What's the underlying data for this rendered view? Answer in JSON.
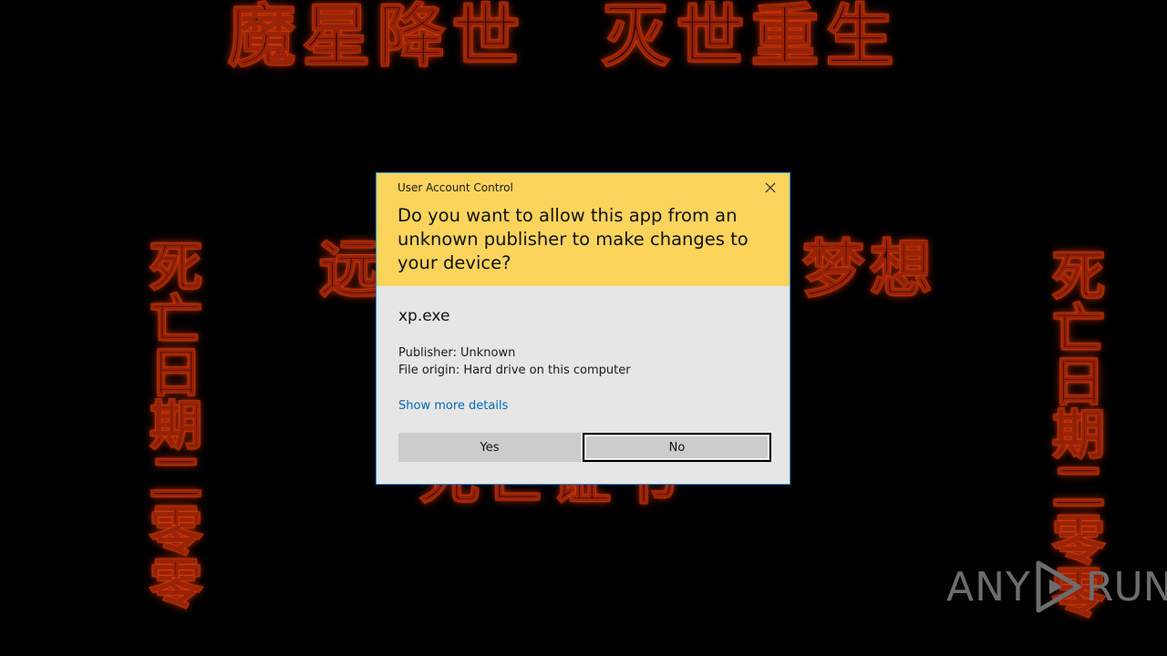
{
  "background": {
    "top_text": "魔星降世　灭世重生",
    "mid_left_text": "远",
    "mid_right_text": "梦想",
    "bottom_text": "死亡证书",
    "left_column": "死亡日期二零零",
    "right_column": "死亡日期二零零"
  },
  "uac": {
    "title": "User Account Control",
    "question": "Do you want to allow this app from an unknown publisher to make changes to your device?",
    "app_name": "xp.exe",
    "publisher": "Publisher: Unknown",
    "file_origin": "File origin: Hard drive on this computer",
    "more_details_link": "Show more details",
    "yes_label": "Yes",
    "no_label": "No",
    "header_color": "#fcd45b",
    "body_color": "#e6e6e6",
    "link_color": "#0068b7",
    "close_icon": "close-icon"
  },
  "watermark": {
    "left_text": "ANY",
    "right_text": "RUN",
    "icon": "play-triangle-icon"
  }
}
